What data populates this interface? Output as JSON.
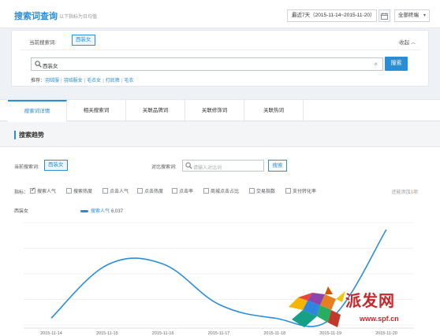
{
  "header": {
    "title": "搜索词查询",
    "subtitle": "以下指标为日均值",
    "date_range": "最近7天（2015-11-14~2015-11-20）",
    "terminal": "全部终端"
  },
  "search_panel": {
    "current_label": "当前搜索词:",
    "current_term": "西装女",
    "collapse": "收起",
    "input_value": "西装女",
    "search_button": "搜索",
    "recommend_label": "推荐：",
    "recommend": [
      "羽绒服",
      "羽绒服女",
      "毛衣女",
      "打底裤",
      "毛衣"
    ]
  },
  "tabs": [
    "搜索词详情",
    "相关搜索词",
    "关联品牌词",
    "关联修饰词",
    "关联热词"
  ],
  "trend": {
    "section_title": "搜索趋势",
    "current_label": "当前搜索词:",
    "current_term": "西装女",
    "compare_label": "对比搜索词:",
    "compare_placeholder": "请输入对比词",
    "compare_button": "搜索",
    "metrics_label": "指标：",
    "metrics": [
      {
        "label": "搜索人气",
        "checked": true
      },
      {
        "label": "搜索热度",
        "checked": false
      },
      {
        "label": "点击人气",
        "checked": false
      },
      {
        "label": "点击热度",
        "checked": false
      },
      {
        "label": "点击率",
        "checked": false
      },
      {
        "label": "商城点击占比",
        "checked": false
      },
      {
        "label": "交易指数",
        "checked": false
      },
      {
        "label": "支付转化率",
        "checked": false
      }
    ],
    "add_tip_prefix": "还能添加",
    "add_tip_count": "1",
    "add_tip_suffix": "项",
    "series_label": "西装女",
    "legend_name": "搜索人气",
    "legend_value": "6,037"
  },
  "chart_data": {
    "type": "line",
    "x": [
      "2015-11-14",
      "2015-11-15",
      "2015-11-16",
      "2015-11-17",
      "2015-11-18",
      "2015-11-19",
      "2015-11-20"
    ],
    "series": [
      {
        "name": "搜索人气",
        "values": [
          6020,
          6074,
          6075,
          6034,
          6020,
          6019,
          6110
        ],
        "color": "#2a8ed6"
      }
    ],
    "ylim": [
      6013,
      6117
    ],
    "grid": true
  },
  "watermark": {
    "brand": "派发网",
    "url": "www.spf.cn"
  }
}
